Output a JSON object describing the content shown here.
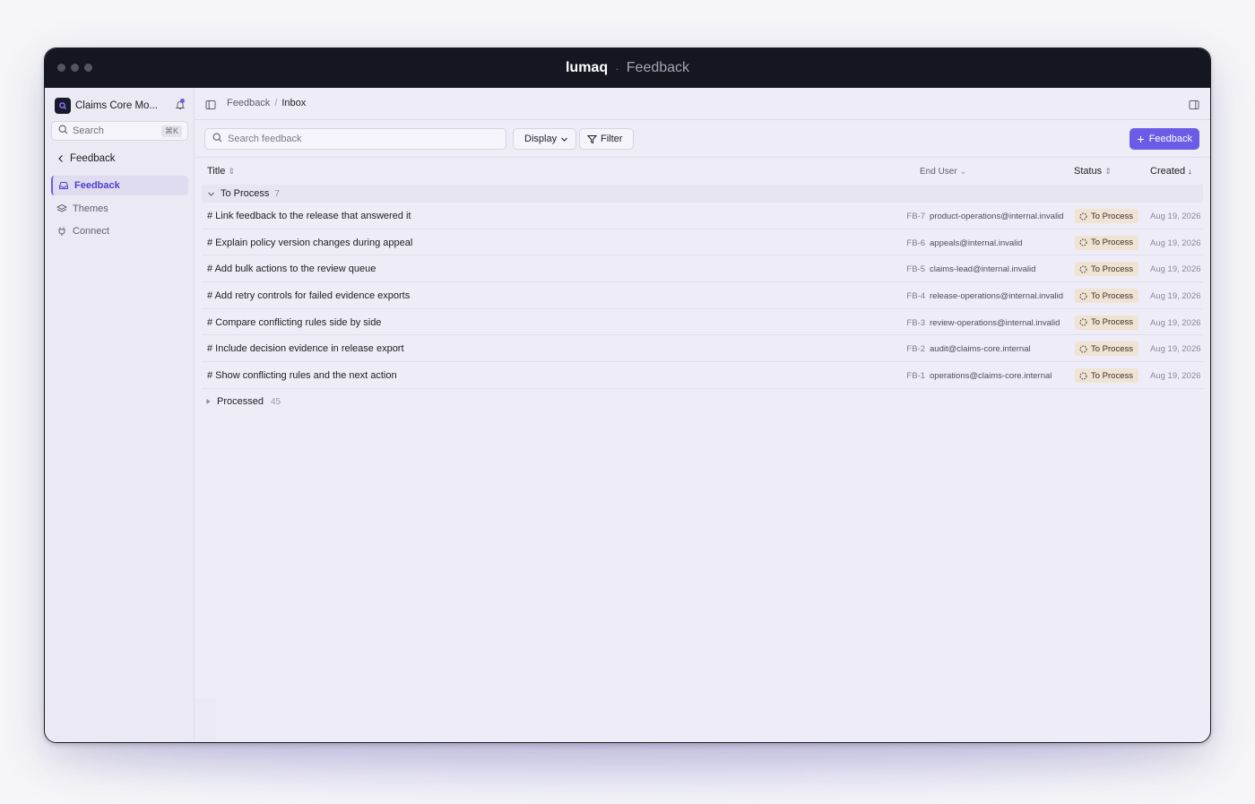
{
  "window": {
    "app_name": "lumaq",
    "separator": "·",
    "page_name": "Feedback"
  },
  "sidebar": {
    "workspace": "Claims Core Mo...",
    "search": {
      "label": "Search",
      "shortcut": "⌘K"
    },
    "back_label": "Feedback",
    "items": [
      {
        "label": "Feedback",
        "icon": "inbox-icon",
        "active": true
      },
      {
        "label": "Themes",
        "icon": "layers-icon",
        "active": false
      },
      {
        "label": "Connect",
        "icon": "plug-icon",
        "active": false
      }
    ]
  },
  "breadcrumb": {
    "root": "Feedback",
    "separator": "/",
    "current": "Inbox"
  },
  "toolbar": {
    "search_placeholder": "Search feedback",
    "display_label": "Display",
    "filter_label": "Filter",
    "new_label": "Feedback"
  },
  "table": {
    "columns": {
      "title": "Title",
      "end_user": "End User",
      "status": "Status",
      "created": "Created"
    },
    "group_open": {
      "label": "To Process",
      "count": "7"
    },
    "rows": [
      {
        "title": "# Link feedback to the release that answered it",
        "id": "FB-7",
        "email": "product-operations@internal.invalid",
        "status": "To Process",
        "created": "Aug 19, 2026"
      },
      {
        "title": "# Explain policy version changes during appeal",
        "id": "FB-6",
        "email": "appeals@internal.invalid",
        "status": "To Process",
        "created": "Aug 19, 2026"
      },
      {
        "title": "# Add bulk actions to the review queue",
        "id": "FB-5",
        "email": "claims-lead@internal.invalid",
        "status": "To Process",
        "created": "Aug 19, 2026"
      },
      {
        "title": "# Add retry controls for failed evidence exports",
        "id": "FB-4",
        "email": "release-operations@internal.invalid",
        "status": "To Process",
        "created": "Aug 19, 2026"
      },
      {
        "title": "# Compare conflicting rules side by side",
        "id": "FB-3",
        "email": "review-operations@internal.invalid",
        "status": "To Process",
        "created": "Aug 19, 2026"
      },
      {
        "title": "# Include decision evidence in release export",
        "id": "FB-2",
        "email": "audit@claims-core.internal",
        "status": "To Process",
        "created": "Aug 19, 2026"
      },
      {
        "title": "# Show conflicting rules and the next action",
        "id": "FB-1",
        "email": "operations@claims-core.internal",
        "status": "To Process",
        "created": "Aug 19, 2026"
      }
    ],
    "group_closed": {
      "label": "Processed",
      "count": "45"
    }
  },
  "colors": {
    "accent": "#6b5ce7",
    "titlebar": "#141720",
    "badge_bg": "#efe3d4"
  }
}
